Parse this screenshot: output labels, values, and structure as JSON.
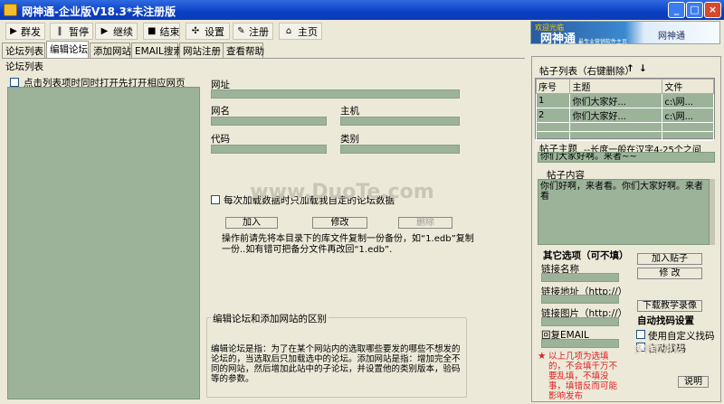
{
  "window": {
    "title": "网神通-企业版V18.3*未注册版"
  },
  "toolbar": [
    {
      "icon": "▶",
      "label": "群发"
    },
    {
      "icon": "‖",
      "label": "暂停"
    },
    {
      "icon": "▶",
      "label": "继续"
    },
    {
      "icon": "■",
      "label": "结束"
    },
    {
      "icon": "✣",
      "label": "设置"
    },
    {
      "icon": "✎",
      "label": "注册"
    },
    {
      "icon": "⌂",
      "label": "主页"
    }
  ],
  "banner": {
    "brand": "网神通",
    "slogan": "欢迎光临",
    "sub": "最专业营销软件主页",
    "right": "网神通"
  },
  "tabs": [
    "论坛列表",
    "编辑论坛",
    "添加网站",
    "EMAIL搜索",
    "网站注册",
    "查看帮助"
  ],
  "list_title": "论坛列表",
  "open_on_click_label": "点击列表项时同时打开先打开相应网页",
  "form": {
    "url_label": "网址",
    "name_label": "网名",
    "host_label": "主机",
    "code_label": "代码",
    "category_label": "类别",
    "load_only_own": "每次加载数据时只加载我自定的论坛数据",
    "add_btn": "加入",
    "edit_btn": "修改",
    "delete_btn": "删除",
    "note": "操作前请先将本目录下的库文件复制一份备份，如“1.edb”复制一份..如有错可把备分文件再改回“1.edb”.",
    "diff_title": "编辑论坛和添加网站的区别",
    "diff_text": "编辑论坛是指：为了在某个网站内的选取哪些要发的哪些不想发的论坛的，当选取后只加载选中的论坛。添加网站是指：增加完全不同的网站，然后增加此站中的子论坛，并设置他的类别版本，验码等的参数。"
  },
  "posts": {
    "title": "帖子列表（右键删除）",
    "up": "↑",
    "down": "↓",
    "columns": [
      "序号",
      "主题",
      "文件"
    ],
    "rows": [
      [
        "1",
        "你们大家好...",
        "c:\\网..."
      ],
      [
        "2",
        "你们大家好...",
        "c:\\网..."
      ]
    ]
  },
  "subject": {
    "label": "帖子主题",
    "hint": "--长度一般在汉字4-25个之间",
    "value": "你们大家好啊。来者~~"
  },
  "content": {
    "label": "帖子内容",
    "value": "你们好啊，来者看。你们大家好啊。来者看"
  },
  "other": {
    "title": "其它选项（可不填）",
    "link_name": "链接名称",
    "link_url": "链接地址（http://）",
    "link_img": "链接图片（http://）",
    "reply_email": "回复EMAIL"
  },
  "actions": {
    "add_post": "加入贴子",
    "edit": "修 改",
    "download": "下载教学录像"
  },
  "captcha": {
    "title": "自动找码设置",
    "custom": "使用自定义找码",
    "auto": "自动找码",
    "help": "说明"
  },
  "warn": "以上几项为选填的，不会填千万不要乱填，不填没事，填错反而可能影响发布",
  "watermark": {
    "site": "www.DuoTe.com",
    "corner": "多特软件站"
  }
}
